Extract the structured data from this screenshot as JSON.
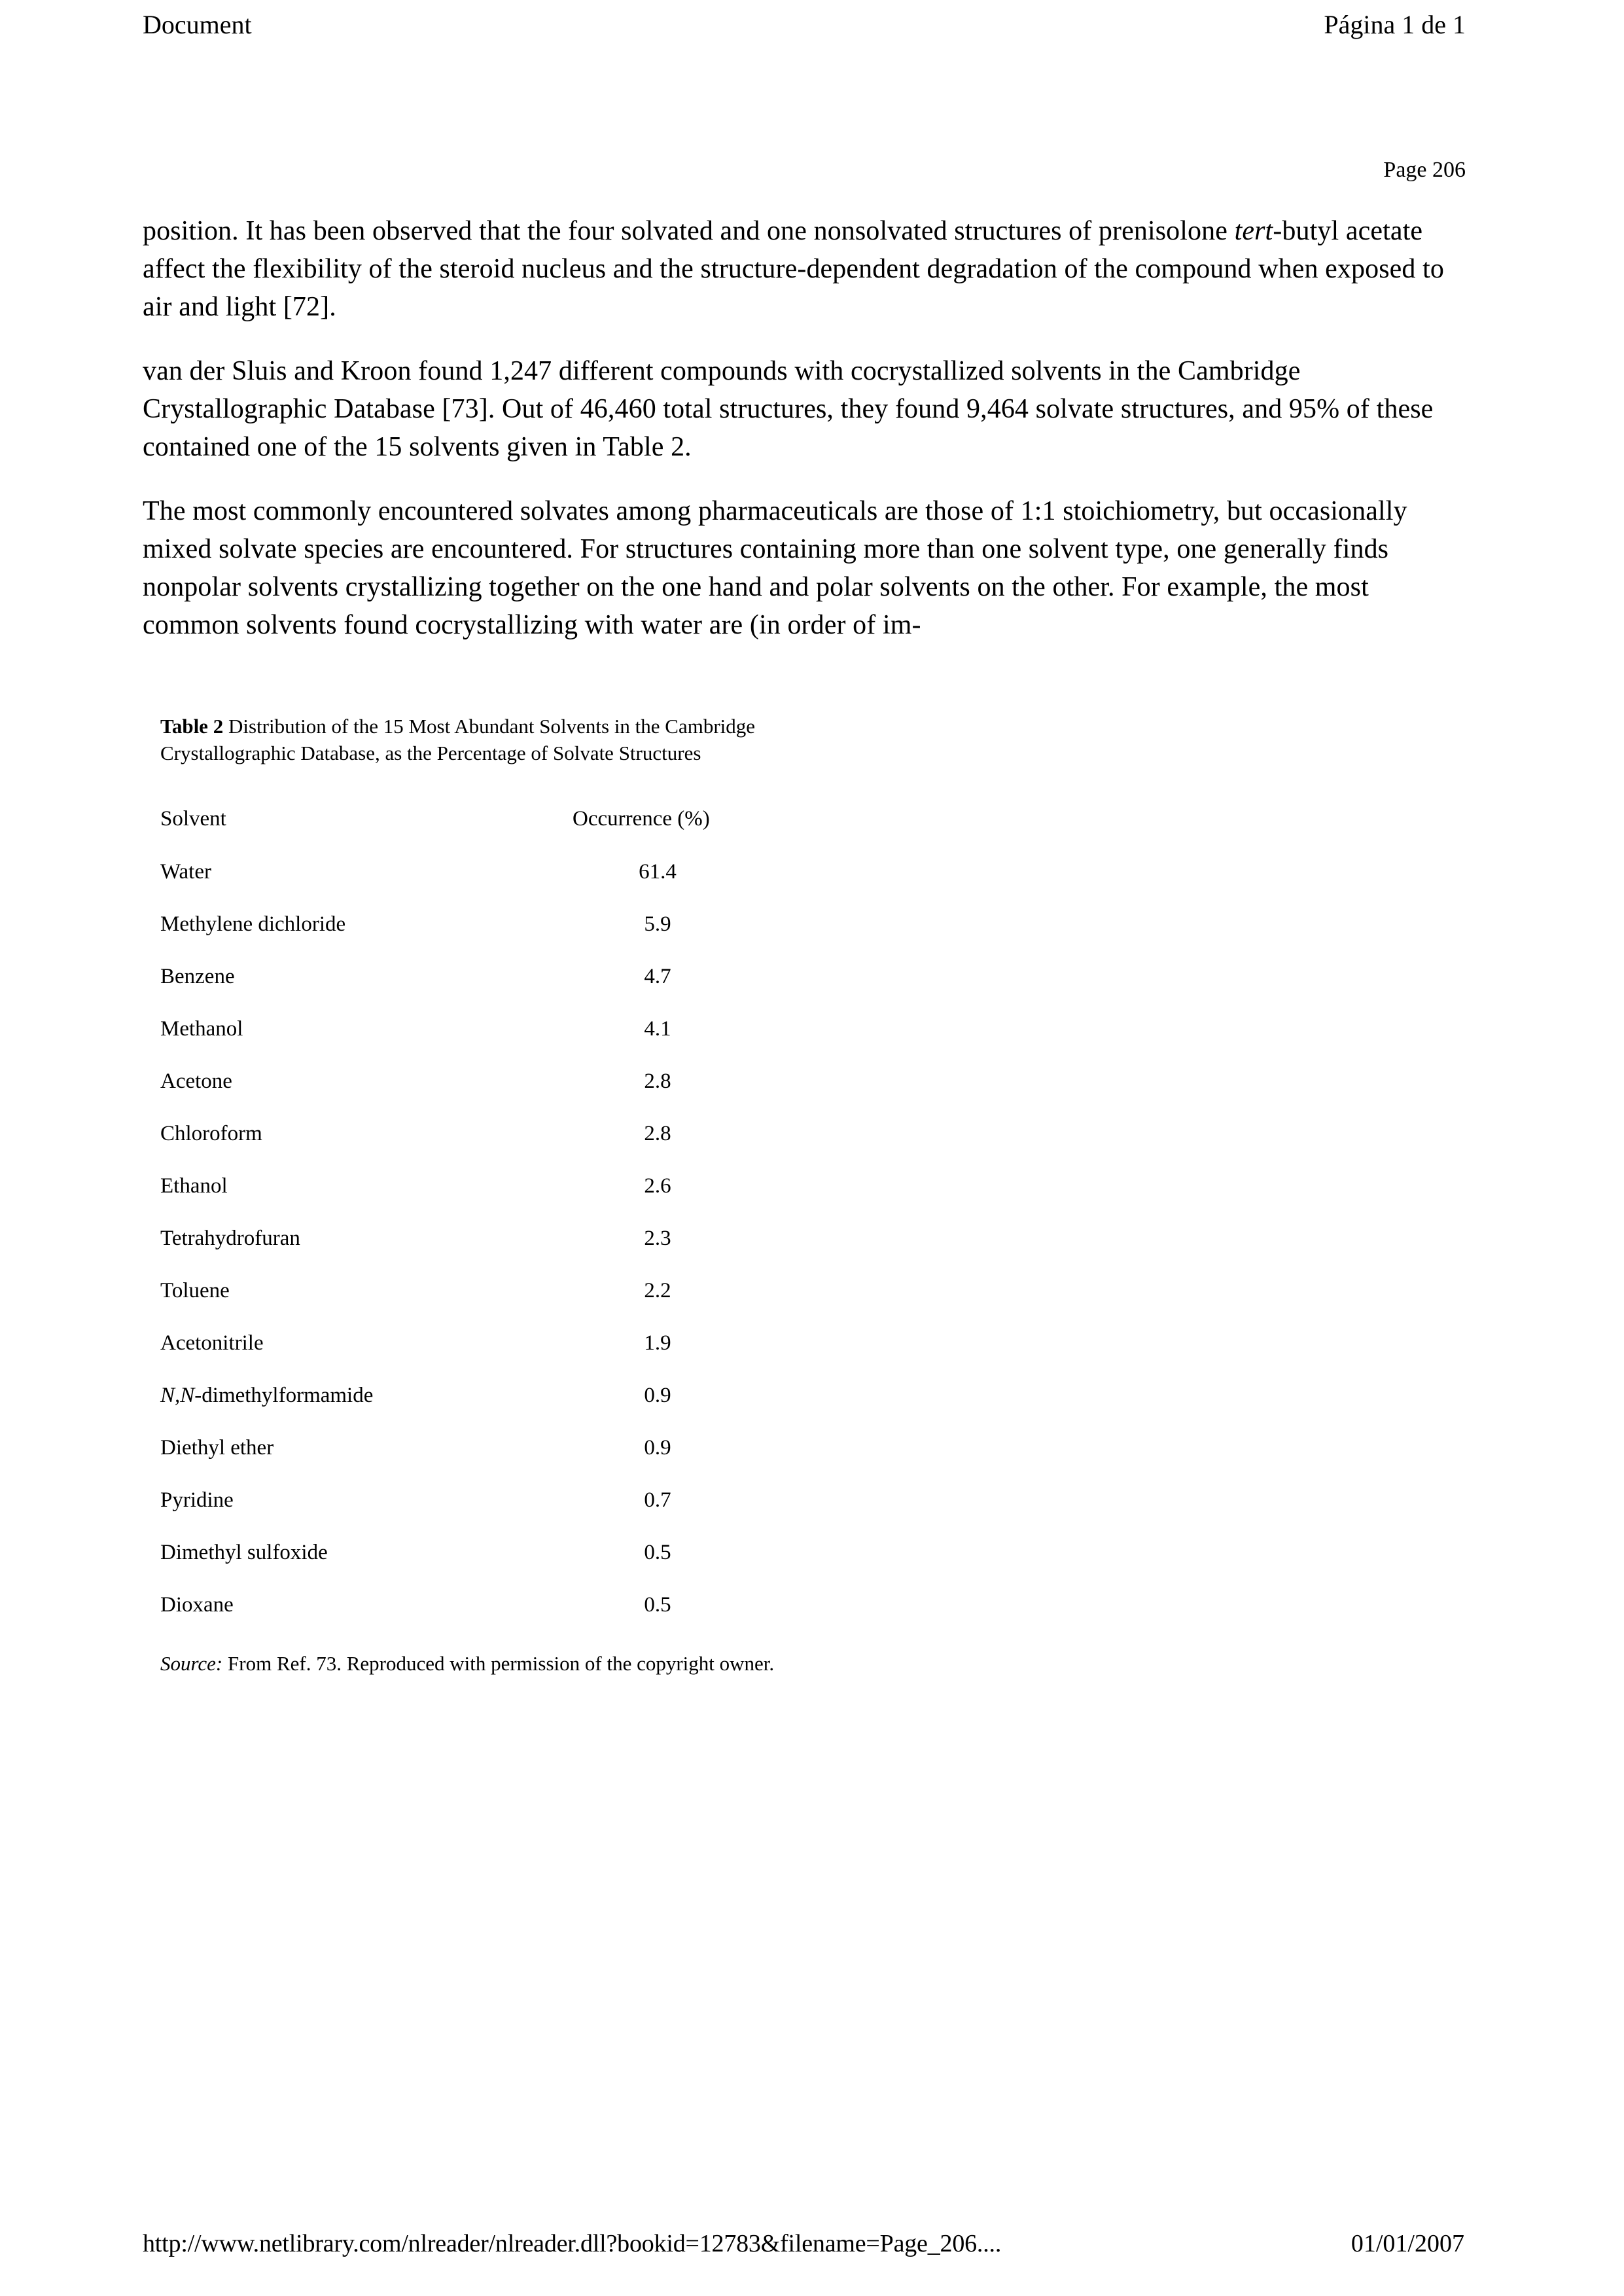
{
  "browser_header": {
    "document_title": "Document",
    "page_indicator": "Página 1 de 1"
  },
  "page_label": "Page 206",
  "paragraphs": {
    "p1_a": "position. It has been observed that the four solvated and one nonsolvated structures of prenisolone ",
    "p1_italic": "tert",
    "p1_b": "-butyl acetate affect the flexibility of the steroid nucleus and the structure-dependent degradation of the compound when exposed to air and light [72].",
    "p2": "van der Sluis and Kroon found 1,247 different compounds with cocrystallized solvents in the Cambridge Crystallographic Database [73]. Out of 46,460 total structures, they found 9,464 solvate structures, and 95% of these contained one of the 15 solvents given in Table 2.",
    "p3": "The most commonly encountered solvates among pharmaceuticals are those of 1:1 stoichiometry, but occasionally mixed solvate species are encountered. For structures containing more than one solvent type, one generally finds nonpolar solvents crystallizing together on the one hand and polar solvents on the other. For example, the most common solvents found cocrystallizing with water are (in order of im-"
  },
  "table": {
    "caption_label": "Table 2",
    "caption_text": " Distribution of the 15 Most Abundant Solvents in the Cambridge Crystallographic Database, as the Percentage of Solvate Structures",
    "headers": {
      "solvent": "Solvent",
      "occurrence": "Occurrence (%)"
    },
    "rows": [
      {
        "solvent": "Water",
        "occurrence": "61.4"
      },
      {
        "solvent": "Methylene dichloride",
        "occurrence": "5.9"
      },
      {
        "solvent": "Benzene",
        "occurrence": "4.7"
      },
      {
        "solvent": "Methanol",
        "occurrence": "4.1"
      },
      {
        "solvent": "Acetone",
        "occurrence": "2.8"
      },
      {
        "solvent": "Chloroform",
        "occurrence": "2.8"
      },
      {
        "solvent": "Ethanol",
        "occurrence": "2.6"
      },
      {
        "solvent": "Tetrahydrofuran",
        "occurrence": "2.3"
      },
      {
        "solvent": "Toluene",
        "occurrence": "2.2"
      },
      {
        "solvent": "Acetonitrile",
        "occurrence": "1.9"
      },
      {
        "solvent": "N,N-dimethylformamide",
        "occurrence": "0.9",
        "italic_prefix": "N,N"
      },
      {
        "solvent": "Diethyl ether",
        "occurrence": "0.9"
      },
      {
        "solvent": "Pyridine",
        "occurrence": "0.7"
      },
      {
        "solvent": "Dimethyl sulfoxide",
        "occurrence": "0.5"
      },
      {
        "solvent": "Dioxane",
        "occurrence": "0.5"
      }
    ],
    "source_label": "Source:",
    "source_text": " From Ref. 73. Reproduced with permission of the copyright owner."
  },
  "browser_footer": {
    "url": "http://www.netlibrary.com/nlreader/nlreader.dll?bookid=12783&filename=Page_206....",
    "date": "01/01/2007"
  },
  "chart_data": {
    "type": "table",
    "title": "Table 2 Distribution of the 15 Most Abundant Solvents in the Cambridge Crystallographic Database, as the Percentage of Solvate Structures",
    "columns": [
      "Solvent",
      "Occurrence (%)"
    ],
    "categories": [
      "Water",
      "Methylene dichloride",
      "Benzene",
      "Methanol",
      "Acetone",
      "Chloroform",
      "Ethanol",
      "Tetrahydrofuran",
      "Toluene",
      "Acetonitrile",
      "N,N-dimethylformamide",
      "Diethyl ether",
      "Pyridine",
      "Dimethyl sulfoxide",
      "Dioxane"
    ],
    "values": [
      61.4,
      5.9,
      4.7,
      4.1,
      2.8,
      2.8,
      2.6,
      2.3,
      2.2,
      1.9,
      0.9,
      0.9,
      0.7,
      0.5,
      0.5
    ],
    "ylabel": "Occurrence (%)",
    "xlabel": "Solvent"
  }
}
